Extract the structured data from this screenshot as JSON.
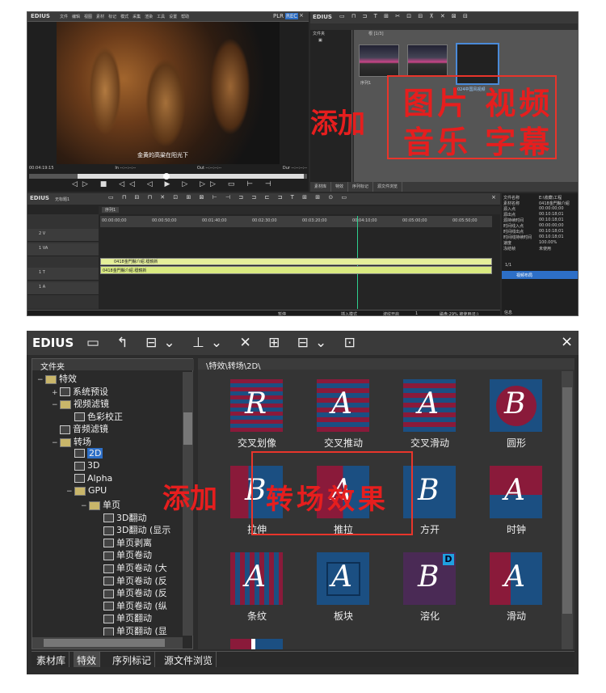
{
  "top": {
    "app": "EDIUS",
    "menu": [
      "文件",
      "编辑",
      "视图",
      "素材",
      "标记",
      "模式",
      "采集",
      "渲染",
      "工具",
      "设置",
      "帮助"
    ],
    "plr": "PLR",
    "rec": "REC",
    "subtitle": "金黄的高粱在阳光下",
    "tc_cur": "00:04:19:15",
    "tc_in": "In --:--:--:--",
    "tc_out": "Out --:--:--:--",
    "tc_dur": "Dur --:--:--:--",
    "bin_app": "EDIUS",
    "bin_folder_tab": "文件夹",
    "bin_path": "根 [1/3]",
    "clip_labels": [
      "序列1",
      "",
      "024中国风视频"
    ],
    "bin_tabs": [
      "素材库",
      "特效",
      "序列标记",
      "源文件浏览"
    ],
    "overlay_line1": "图片 视频",
    "overlay_line2": "音乐 字幕",
    "overlay_add": "添加",
    "tl_title": "EDIUS",
    "tl_seq": "无标题1",
    "tl_tab": "序列1",
    "ruler": [
      "00:00:00;00",
      "00:00:50;00",
      "00:01:40;00",
      "00:02:30;00",
      "00:03:20;00",
      "00:04:10;00",
      "00:05:00;00",
      "00:05:50;00"
    ],
    "tracks": [
      "2 V",
      "1 VA",
      "1 T",
      "1 A"
    ],
    "clip_v": "0418金門縣介紹.穩鏡新",
    "clip_a": "0418金門縣介紹.穩鏡新",
    "status": [
      "暂停",
      "插入模式",
      "波纹开启",
      "1",
      "磁盘:29% 被使用(E:)"
    ],
    "info_labels": [
      "文件名称",
      "素材名称",
      "源入点",
      "源出点",
      "源持续时间",
      "时间线入点",
      "时间线出点",
      "时间线持续时间",
      "速度",
      "冻结帧"
    ],
    "info_values": [
      "E:\\收藏\\工程",
      "0418金門縣介紹",
      "00:00:00;00",
      "00:10:18;01",
      "00:10:18;01",
      "00:00:00;00",
      "00:10:18;01",
      "00:10:18;01",
      "100.00%",
      "未使用"
    ],
    "info_count": "1/1",
    "info_item": "视频布局",
    "info_tab": "信息"
  },
  "bottom": {
    "app": "EDIUS",
    "folder_header": "文件夹",
    "path": "\\特效\\转场\\2D\\",
    "tree": [
      {
        "label": "特效",
        "depth": 0,
        "type": "folder",
        "exp": "−"
      },
      {
        "label": "系统预设",
        "depth": 1,
        "type": "file",
        "exp": "+"
      },
      {
        "label": "视频滤镜",
        "depth": 1,
        "type": "folder",
        "exp": "−"
      },
      {
        "label": "色彩校正",
        "depth": 2,
        "type": "file",
        "exp": ""
      },
      {
        "label": "音频滤镜",
        "depth": 1,
        "type": "file",
        "exp": ""
      },
      {
        "label": "转场",
        "depth": 1,
        "type": "folder",
        "exp": "−"
      },
      {
        "label": "2D",
        "depth": 2,
        "type": "file",
        "exp": "",
        "sel": true
      },
      {
        "label": "3D",
        "depth": 2,
        "type": "file",
        "exp": ""
      },
      {
        "label": "Alpha",
        "depth": 2,
        "type": "file",
        "exp": ""
      },
      {
        "label": "GPU",
        "depth": 2,
        "type": "folder",
        "exp": "−"
      },
      {
        "label": "单页",
        "depth": 3,
        "type": "folder",
        "exp": "−"
      },
      {
        "label": "3D翻动",
        "depth": 4,
        "type": "file",
        "exp": ""
      },
      {
        "label": "3D翻动 (显示",
        "depth": 4,
        "type": "file",
        "exp": ""
      },
      {
        "label": "单页剥离",
        "depth": 4,
        "type": "file",
        "exp": ""
      },
      {
        "label": "单页卷动",
        "depth": 4,
        "type": "file",
        "exp": ""
      },
      {
        "label": "单页卷动 (大",
        "depth": 4,
        "type": "file",
        "exp": ""
      },
      {
        "label": "单页卷动 (反",
        "depth": 4,
        "type": "file",
        "exp": ""
      },
      {
        "label": "单页卷动 (反",
        "depth": 4,
        "type": "file",
        "exp": ""
      },
      {
        "label": "单页卷动 (纵",
        "depth": 4,
        "type": "file",
        "exp": ""
      },
      {
        "label": "单页翻动",
        "depth": 4,
        "type": "file",
        "exp": ""
      },
      {
        "label": "单页翻动 (显",
        "depth": 4,
        "type": "file",
        "exp": ""
      }
    ],
    "effects": [
      "交叉划像",
      "交叉推动",
      "交叉滑动",
      "圆形",
      "拉伸",
      "推拉",
      "方开",
      "时钟",
      "条纹",
      "板块",
      "溶化",
      "滑动"
    ],
    "tabs": [
      "素材库",
      "特效",
      "序列标记",
      "源文件浏览"
    ],
    "overlay_add": "添加",
    "overlay_box": "转场效果",
    "badge": "D",
    "close": "×"
  },
  "colors": {
    "annotation": "#e61e1e",
    "tile_red": "#8a1a3a",
    "tile_blue": "#1b4f82",
    "lime": "#e5ef9a"
  }
}
